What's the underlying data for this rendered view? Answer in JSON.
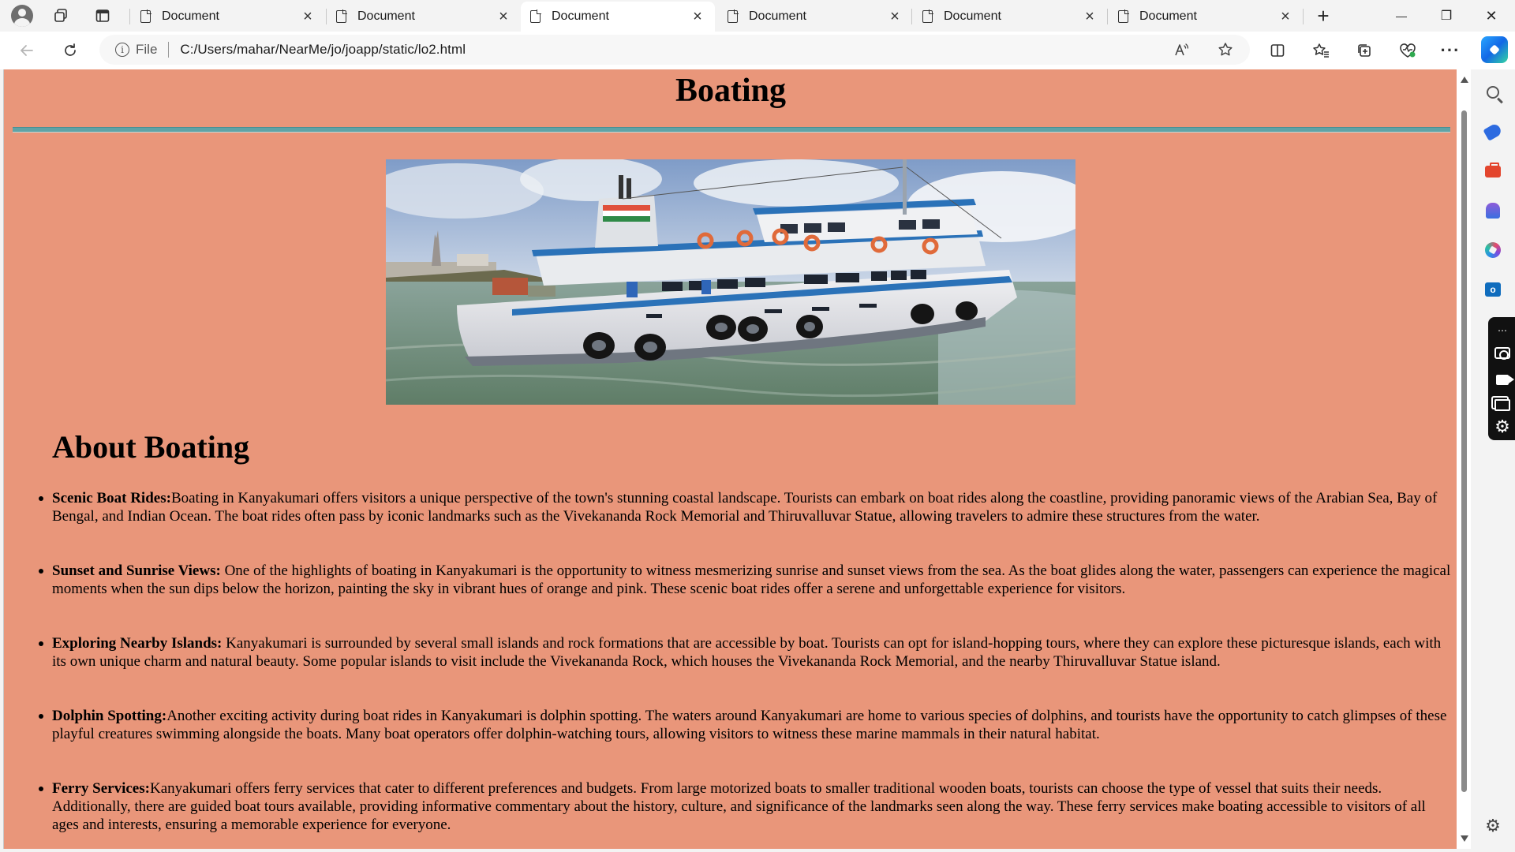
{
  "browser": {
    "tabs": [
      {
        "title": "Document",
        "active": false
      },
      {
        "title": "Document",
        "active": false
      },
      {
        "title": "Document",
        "active": true
      },
      {
        "title": "Document",
        "active": false
      },
      {
        "title": "Document",
        "active": false
      },
      {
        "title": "Document",
        "active": false
      }
    ],
    "new_tab_glyph": "+",
    "window_controls": {
      "minimize": "—",
      "restore": "❐",
      "close": "✕"
    },
    "address": {
      "scheme_label": "File",
      "url": "C:/Users/mahar/NearMe/jo/joapp/static/lo2.html"
    },
    "toolbar_icons": [
      "back-icon",
      "refresh-icon",
      "read-aloud-icon",
      "favorite-star-icon",
      "split-screen-icon",
      "favorites-icon",
      "collections-icon",
      "browser-essentials-icon",
      "more-icon",
      "copilot-icon"
    ],
    "sidebar_icons": [
      "search-icon",
      "shopping-tag-icon",
      "tools-briefcase-icon",
      "games-icon",
      "microsoft-365-icon",
      "outlook-icon",
      "settings-gear-icon"
    ]
  },
  "page": {
    "title": "Boating",
    "rule_color": "#5fa3a6",
    "background_color": "#e9967a",
    "image_subject": "boat-photo",
    "about_heading": "About Boating",
    "topics": [
      {
        "term": "Scenic Boat Rides:",
        "text": "Boating in Kanyakumari offers visitors a unique perspective of the town's stunning coastal landscape. Tourists can embark on boat rides along the coastline, providing panoramic views of the Arabian Sea, Bay of Bengal, and Indian Ocean. The boat rides often pass by iconic landmarks such as the Vivekananda Rock Memorial and Thiruvalluvar Statue, allowing travelers to admire these structures from the water."
      },
      {
        "term": "Sunset and Sunrise Views:",
        "text": " One of the highlights of boating in Kanyakumari is the opportunity to witness mesmerizing sunrise and sunset views from the sea. As the boat glides along the water, passengers can experience the magical moments when the sun dips below the horizon, painting the sky in vibrant hues of orange and pink. These scenic boat rides offer a serene and unforgettable experience for visitors."
      },
      {
        "term": "Exploring Nearby Islands:",
        "text": " Kanyakumari is surrounded by several small islands and rock formations that are accessible by boat. Tourists can opt for island-hopping tours, where they can explore these picturesque islands, each with its own unique charm and natural beauty. Some popular islands to visit include the Vivekananda Rock, which houses the Vivekananda Rock Memorial, and the nearby Thiruvalluvar Statue island."
      },
      {
        "term": "Dolphin Spotting:",
        "text": "Another exciting activity during boat rides in Kanyakumari is dolphin spotting. The waters around Kanyakumari are home to various species of dolphins, and tourists have the opportunity to catch glimpses of these playful creatures swimming alongside the boats. Many boat operators offer dolphin-watching tours, allowing visitors to witness these marine mammals in their natural habitat."
      },
      {
        "term": "Ferry Services:",
        "text": "Kanyakumari offers ferry services that cater to different preferences and budgets. From large motorized boats to smaller traditional wooden boats, tourists can choose the type of vessel that suits their needs. Additionally, there are guided boat tours available, providing informative commentary about the history, culture, and significance of the landmarks seen along the way. These ferry services make boating accessible to visitors of all ages and interests, ensuring a memorable experience for everyone."
      }
    ]
  }
}
